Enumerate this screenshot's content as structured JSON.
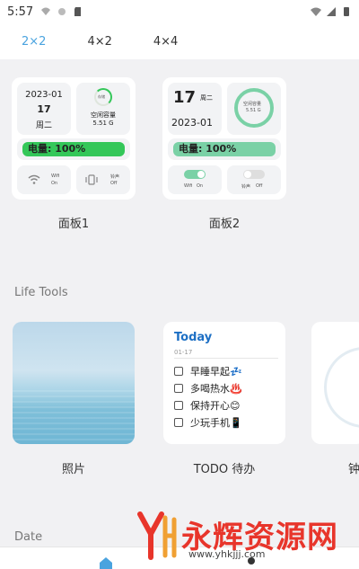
{
  "status": {
    "time": "5:57"
  },
  "tabs": [
    "2×2",
    "4×2",
    "4×4"
  ],
  "panels": [
    {
      "label": "面板1",
      "date": "2023-01",
      "day": "17",
      "weekday": "周二",
      "storage_ring_label": "存储",
      "storage_label": "空闲容量",
      "storage_value": "5.51 G",
      "battery_text": "电量: 100%",
      "battery_level": 1.0,
      "wifi_label": "Wifi",
      "wifi_state": "On",
      "vibrate_label": "铃声",
      "vibrate_state": "Off",
      "accent": "#34c759"
    },
    {
      "label": "面板2",
      "day": "17",
      "weekday": "周二",
      "date": "2023-01",
      "storage_label": "空闲容量",
      "storage_value": "5.51 G",
      "battery_text": "电量: 100%",
      "battery_level": 1.0,
      "wifi_label": "Wifi",
      "wifi_state": "On",
      "vibrate_label": "铃声",
      "vibrate_state": "Off",
      "accent": "#7ad1a6"
    }
  ],
  "sections": {
    "life_tools": "Life Tools",
    "date": "Date"
  },
  "tools": {
    "photo_label": "照片",
    "todo_label": "TODO 待办",
    "clock_label": "钟",
    "todo": {
      "title": "Today",
      "date": "01-17",
      "items": [
        "早睡早起💤",
        "多喝热水♨️",
        "保持开心😊",
        "少玩手机📱"
      ]
    }
  },
  "watermark": {
    "brand": "永辉资源网",
    "url": "www.yhkjjj.com",
    "color": "#e8352b"
  }
}
